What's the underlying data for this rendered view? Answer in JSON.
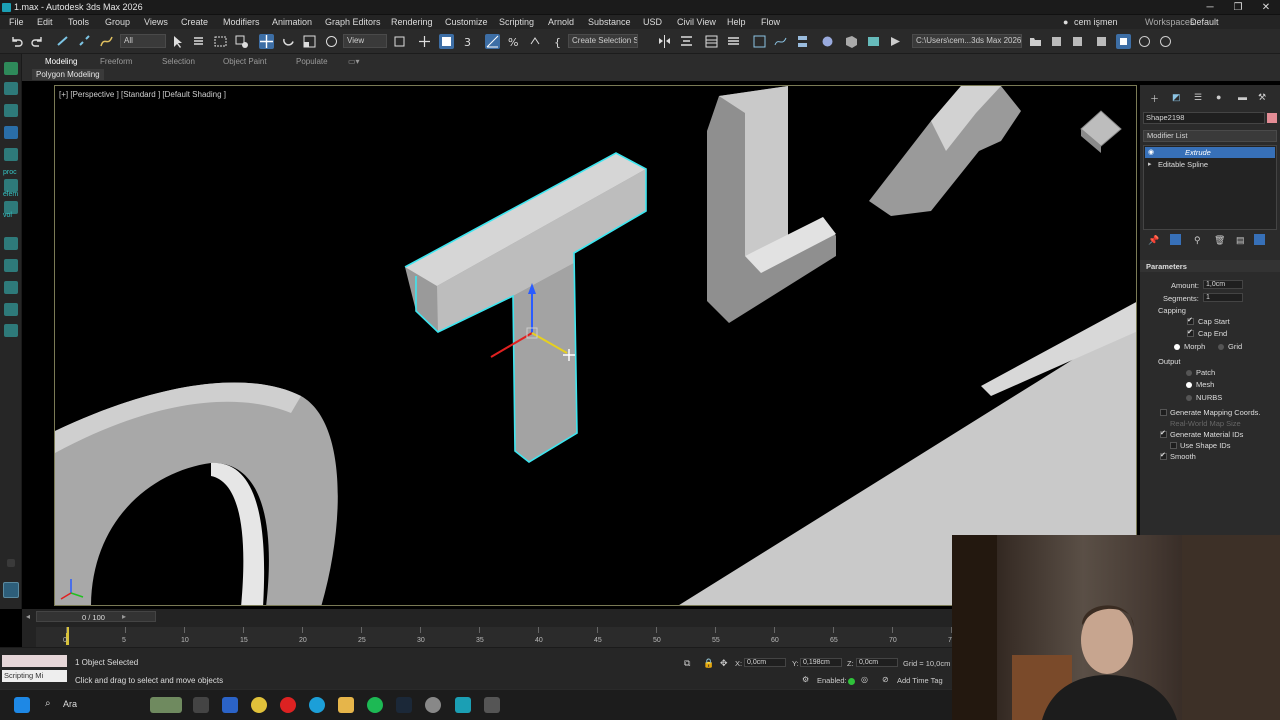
{
  "window": {
    "title": "1.max - Autodesk 3ds Max 2026"
  },
  "menu": [
    "File",
    "Edit",
    "Tools",
    "Group",
    "Views",
    "Create",
    "Modifiers",
    "Animation",
    "Graph Editors",
    "Rendering",
    "Customize",
    "Scripting",
    "Arnold",
    "Substance",
    "USD",
    "Civil View",
    "Help",
    "Flow"
  ],
  "user": {
    "name": "cem işmen",
    "workspaces_label": "Workspaces:",
    "workspace": "Default"
  },
  "toolbar": {
    "selection_filter": "All",
    "ref_coord": "View",
    "named_selection": "Create Selection Se",
    "project_path": "C:\\Users\\cem...3ds Max 2026"
  },
  "ribbon": {
    "tabs": [
      "Modeling",
      "Freeform",
      "Selection",
      "Object Paint",
      "Populate"
    ],
    "active": "Modeling",
    "subpanel": "Polygon Modeling"
  },
  "left_rail": {
    "labels": [
      "proc",
      "elem",
      "vol"
    ]
  },
  "viewport": {
    "label": "[+] [Perspective ] [Standard ] [Default Shading ]",
    "gizmo_axis_x": "x",
    "gizmo_axis_y": "y"
  },
  "command_panel": {
    "object_name": "Shape2198",
    "object_color": "#e38c95",
    "modifier_list_label": "Modifier List",
    "stack": [
      "Extrude",
      "Editable Spline"
    ],
    "rollout_title": "Parameters",
    "amount_label": "Amount:",
    "amount_value": "1,0cm",
    "segments_label": "Segments:",
    "segments_value": "1",
    "capping_label": "Capping",
    "cap_start": "Cap Start",
    "cap_end": "Cap End",
    "morph": "Morph",
    "grid": "Grid",
    "output_label": "Output",
    "patch": "Patch",
    "mesh": "Mesh",
    "nurbs": "NURBS",
    "gen_mapping": "Generate Mapping Coords.",
    "real_world": "Real-World Map Size",
    "gen_matids": "Generate Material IDs",
    "use_shape_ids": "Use Shape IDs",
    "smooth": "Smooth"
  },
  "timeline": {
    "frame_readout": "0 / 100",
    "ticks": [
      "0",
      "5",
      "10",
      "15",
      "20",
      "25",
      "30",
      "35",
      "40",
      "45",
      "50",
      "55",
      "60",
      "65",
      "70",
      "75"
    ]
  },
  "status": {
    "selected": "1 Object Selected",
    "prompt": "Click and drag to select and move objects",
    "script_label": "Scripting Mi",
    "x_label": "X:",
    "x": "0,0cm",
    "y_label": "Y:",
    "y": "0,198cm",
    "z_label": "Z:",
    "z": "0,0cm",
    "grid": "Grid = 10,0cm",
    "enabled": "Enabled:",
    "add_time_tag": "Add Time Tag"
  },
  "taskbar": {
    "search_text": "Ara"
  }
}
